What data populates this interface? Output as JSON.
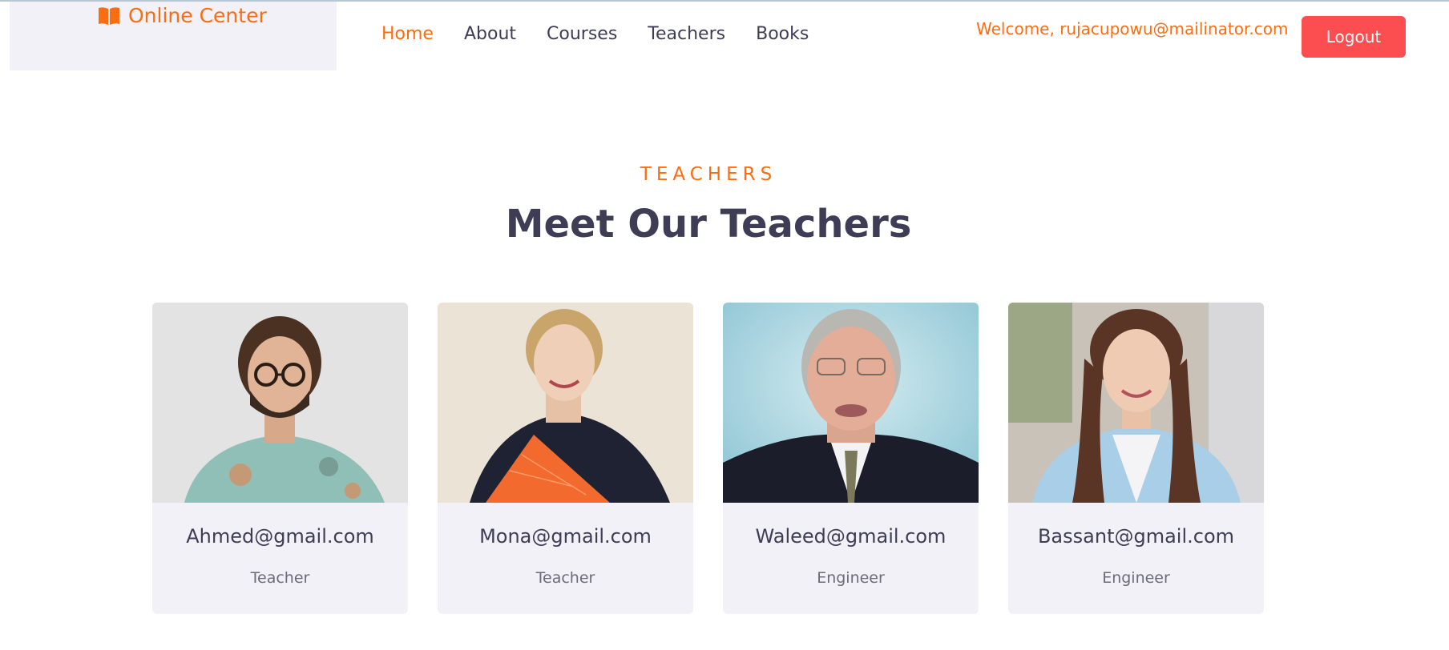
{
  "brand": {
    "name": "Online Center",
    "icon": "book-icon"
  },
  "nav": {
    "items": [
      {
        "label": "Home",
        "active": true
      },
      {
        "label": "About",
        "active": false
      },
      {
        "label": "Courses",
        "active": false
      },
      {
        "label": "Teachers",
        "active": false
      },
      {
        "label": "Books",
        "active": false
      }
    ]
  },
  "user": {
    "welcome": "Welcome, rujacupowu@mailinator.com",
    "logout_label": "Logout"
  },
  "section": {
    "kicker": "TEACHERS",
    "title": "Meet Our Teachers"
  },
  "teachers": [
    {
      "name": "Ahmed@gmail.com",
      "role": "Teacher"
    },
    {
      "name": "Mona@gmail.com",
      "role": "Teacher"
    },
    {
      "name": "Waleed@gmail.com",
      "role": "Engineer"
    },
    {
      "name": "Bassant@gmail.com",
      "role": "Engineer"
    }
  ],
  "colors": {
    "accent": "#fb6d10",
    "logout": "#fc4d50",
    "text": "#3f3d56",
    "card_bg": "#f2f1f7"
  }
}
